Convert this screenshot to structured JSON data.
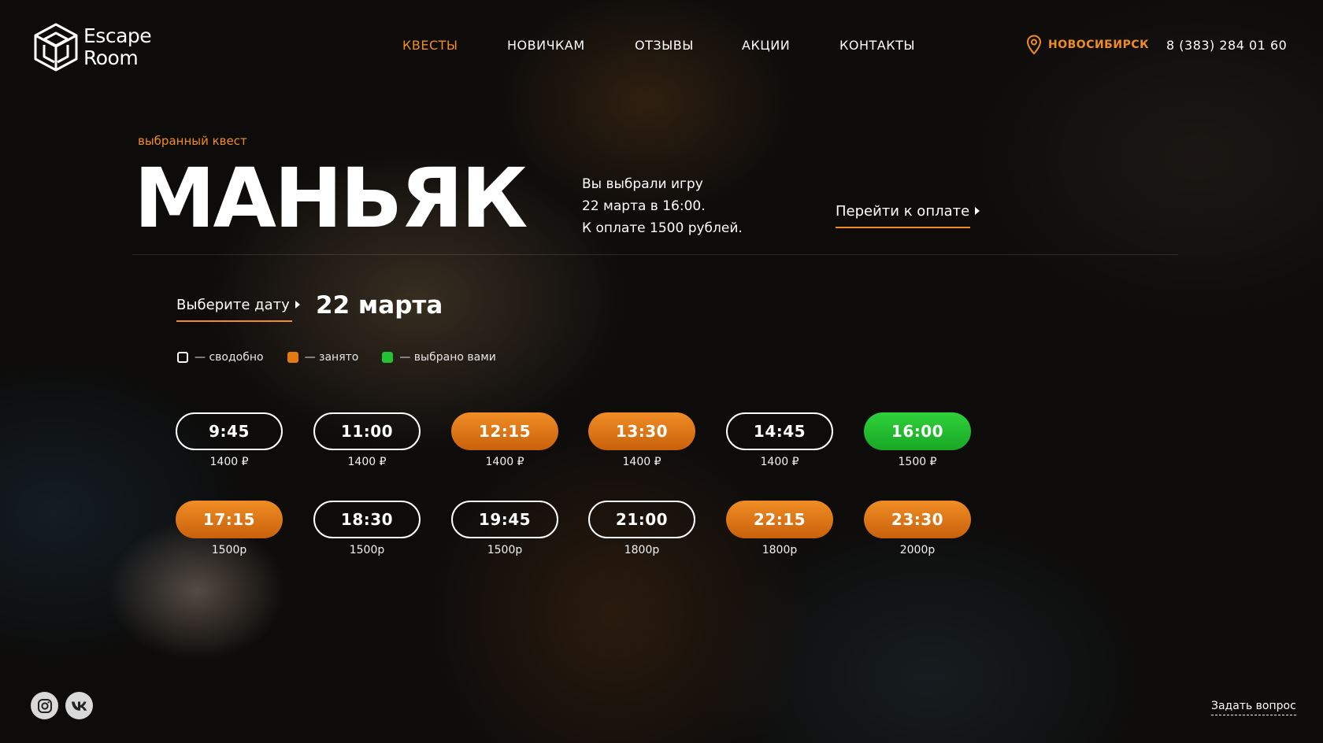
{
  "brand": {
    "line1": "Escape",
    "line2": "Room"
  },
  "nav": {
    "items": [
      {
        "label": "КВЕСТЫ",
        "active": true
      },
      {
        "label": "НОВИЧКАМ",
        "active": false
      },
      {
        "label": "ОТЗЫВЫ",
        "active": false
      },
      {
        "label": "АКЦИИ",
        "active": false
      },
      {
        "label": "КОНТАКТЫ",
        "active": false
      }
    ]
  },
  "header": {
    "city": "НОВОСИБИРСК",
    "phone": "8 (383) 284 01 60"
  },
  "quest": {
    "eyebrow": "выбранный квест",
    "title": "МАНЬЯК",
    "summary": [
      "Вы выбрали игру",
      "22 марта в 16:00.",
      "К оплате 1500 рублей."
    ],
    "pay_label": "Перейти к оплате"
  },
  "date_picker": {
    "label": "Выберите дату",
    "value": "22 марта"
  },
  "legend": {
    "free": "— сводобно",
    "busy": "— занято",
    "mine": "— выбрано вами"
  },
  "slots": [
    {
      "time": "9:45",
      "price": "1400 ₽",
      "status": "free"
    },
    {
      "time": "11:00",
      "price": "1400 ₽",
      "status": "free"
    },
    {
      "time": "12:15",
      "price": "1400 ₽",
      "status": "busy"
    },
    {
      "time": "13:30",
      "price": "1400 ₽",
      "status": "busy"
    },
    {
      "time": "14:45",
      "price": "1400 ₽",
      "status": "free"
    },
    {
      "time": "16:00",
      "price": "1500 ₽",
      "status": "mine"
    },
    {
      "time": "17:15",
      "price": "1500р",
      "status": "busy"
    },
    {
      "time": "18:30",
      "price": "1500р",
      "status": "free"
    },
    {
      "time": "19:45",
      "price": "1500р",
      "status": "free"
    },
    {
      "time": "21:00",
      "price": "1800р",
      "status": "free"
    },
    {
      "time": "22:15",
      "price": "1800р",
      "status": "busy"
    },
    {
      "time": "23:30",
      "price": "2000р",
      "status": "busy"
    }
  ],
  "footer": {
    "ask_label": "Задать вопрос",
    "socials": [
      "instagram-icon",
      "vk-icon"
    ]
  },
  "colors": {
    "accent": "#f28c1f",
    "busy": "#e3790f",
    "selected": "#22c232",
    "background": "#0d0c0b"
  }
}
